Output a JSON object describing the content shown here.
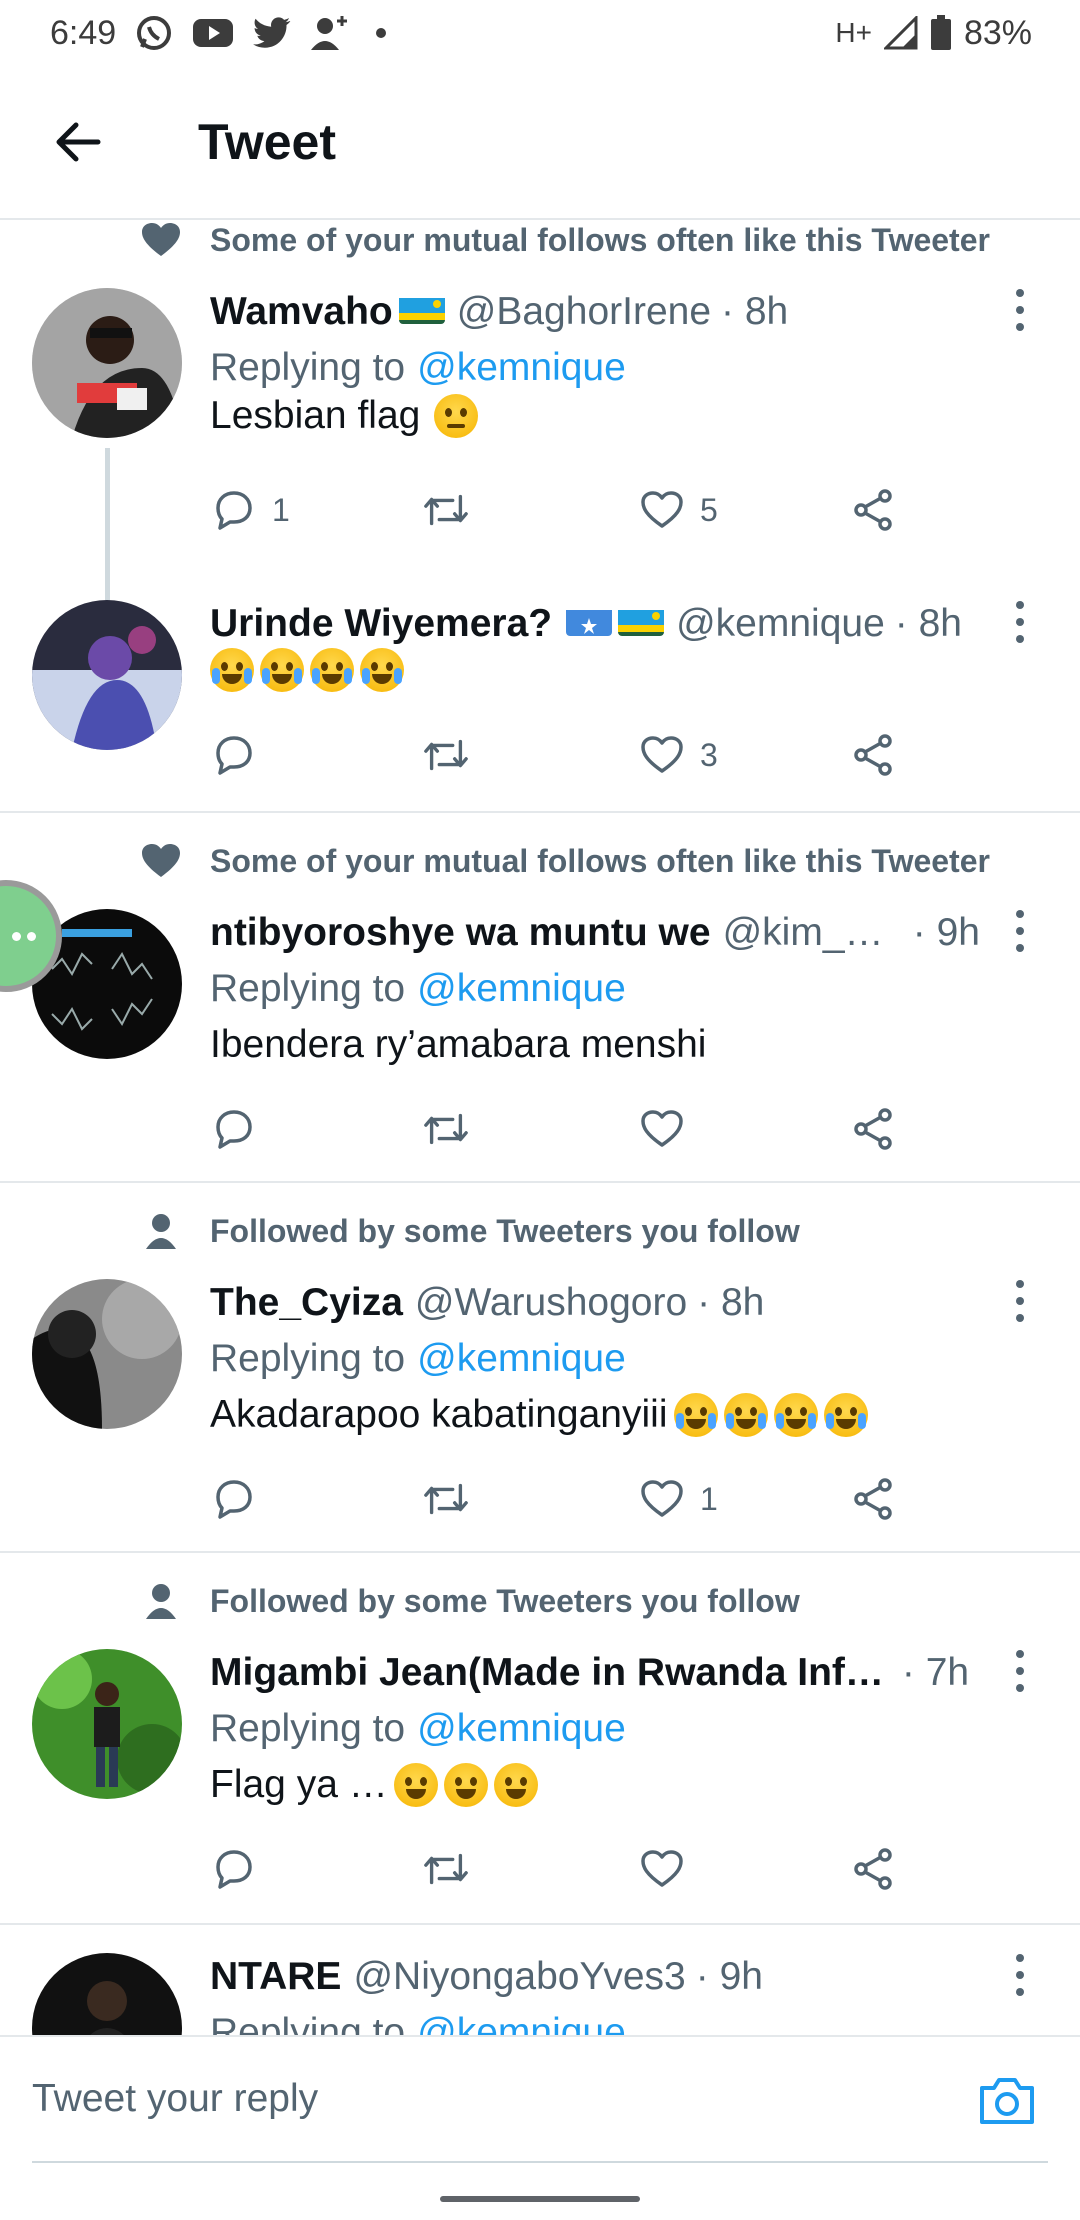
{
  "status_bar": {
    "time": "6:49",
    "network": "H+",
    "battery": "83%",
    "notification_icons": [
      "whatsapp-icon",
      "youtube-icon",
      "twitter-icon",
      "add-person-icon"
    ]
  },
  "header": {
    "title": "Tweet"
  },
  "tweets": [
    {
      "context": "Some of your mutual follows often like this Tweeter",
      "context_icon": "heart-icon",
      "name": "Wamvaho",
      "handle": "@BaghorIrene",
      "time": "· 8h",
      "replying_label": "Replying to",
      "replying_to": "@kemnique",
      "text": "Lesbian flag",
      "emoji": [
        "roll"
      ],
      "replies": "1",
      "retweets": "",
      "likes": "5"
    },
    {
      "name": "Urinde Wiyemera?",
      "handle": "@kemnique",
      "time": "· 8h",
      "text": "",
      "emoji": [
        "cry",
        "cry",
        "cry",
        "cry"
      ],
      "replies": "",
      "retweets": "",
      "likes": "3"
    },
    {
      "context": "Some of your mutual follows often like this Tweeter",
      "context_icon": "heart-icon",
      "name": "ntibyoroshye wa muntu we",
      "handle": "@kim_k…",
      "time": "· 9h",
      "replying_label": "Replying to",
      "replying_to": "@kemnique",
      "text": "Ibendera ry’amabara menshi",
      "emoji": [],
      "replies": "",
      "retweets": "",
      "likes": ""
    },
    {
      "context": "Followed by some Tweeters you follow",
      "context_icon": "person-icon",
      "name": "The_Cyiza",
      "handle": "@Warushogoro",
      "time": "· 8h",
      "replying_label": "Replying to",
      "replying_to": "@kemnique",
      "text": "Akadarapoo kabatinganyiii",
      "emoji": [
        "cry",
        "cry",
        "cry",
        "cry"
      ],
      "replies": "",
      "retweets": "",
      "likes": "1"
    },
    {
      "context": "Followed by some Tweeters you follow",
      "context_icon": "person-icon",
      "name": "Migambi Jean(Made in Rwanda Inf…",
      "handle": "",
      "time": "· 7h",
      "replying_label": "Replying to",
      "replying_to": "@kemnique",
      "text": "Flag ya …",
      "emoji": [
        "grin",
        "grin",
        "grin"
      ],
      "replies": "",
      "retweets": "",
      "likes": ""
    },
    {
      "name": "NTARE",
      "handle": "@NiyongaboYves3",
      "time": "· 9h",
      "replying_label": "Replying to",
      "replying_to": "@kemnique"
    }
  ],
  "composer": {
    "placeholder": "Tweet your reply"
  },
  "colors": {
    "accent": "#1d9bf0",
    "secondary_text": "#536471",
    "divider": "#e4e8eb"
  }
}
